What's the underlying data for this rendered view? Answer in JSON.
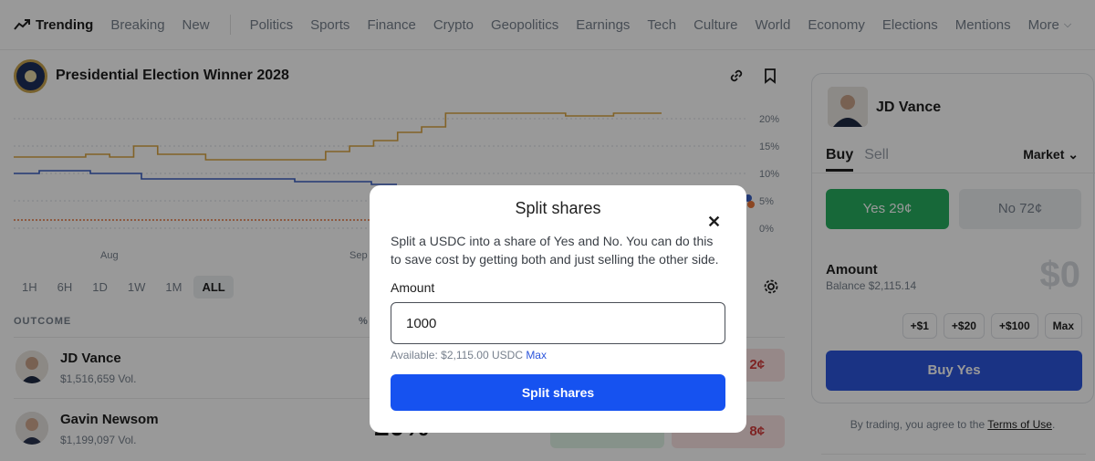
{
  "nav": {
    "trending": "Trending",
    "items": [
      "Breaking",
      "New"
    ],
    "categories": [
      "Politics",
      "Sports",
      "Finance",
      "Crypto",
      "Geopolitics",
      "Earnings",
      "Tech",
      "Culture",
      "World",
      "Economy",
      "Elections",
      "Mentions"
    ],
    "more": "More"
  },
  "market": {
    "title": "Presidential Election Winner 2028"
  },
  "chart_data": {
    "type": "line",
    "x_tick_labels": [
      "Aug",
      "Sep"
    ],
    "y_tick_labels": [
      "20%",
      "15%",
      "10%",
      "5%",
      "0%"
    ],
    "ylim": [
      0,
      21
    ],
    "grid": true,
    "series": [
      {
        "color": "#d9a441",
        "values": [
          13,
          13,
          13,
          13.5,
          13,
          15,
          13.5,
          13.5,
          12.5,
          12.5,
          12.5,
          12.5,
          12.5,
          14,
          15,
          16,
          17.5,
          18.5,
          21,
          21,
          21,
          21,
          21,
          20.5,
          20.5,
          21,
          21,
          21
        ]
      },
      {
        "color": "#3a5fc1",
        "values": [
          10,
          10.5,
          10.5,
          10,
          10,
          9,
          9,
          9,
          9,
          9,
          9,
          8.5,
          8.5,
          8.5,
          8,
          8
        ]
      },
      {
        "color": "#e8763a",
        "values": [
          1.5,
          1.5,
          1.5,
          1.5,
          1.5,
          1.5,
          1.5,
          1.5,
          1.5,
          1.5,
          1.5,
          1.5,
          1.5,
          1.5,
          1.5,
          1.5,
          3,
          4
        ]
      }
    ]
  },
  "ranges": [
    "1H",
    "6H",
    "1D",
    "1W",
    "1M",
    "ALL"
  ],
  "active_range": "ALL",
  "table": {
    "outcome_header": "OUTCOME",
    "pct_header": "%",
    "rows": [
      {
        "name": "JD Vance",
        "vol": "$1,516,659 Vol.",
        "pct": "",
        "no": "2¢"
      },
      {
        "name": "Gavin Newsom",
        "vol": "$1,199,097 Vol.",
        "pct": "20%",
        "no": "8¢"
      }
    ]
  },
  "panel": {
    "name": "JD Vance",
    "buy": "Buy",
    "sell": "Sell",
    "market": "Market",
    "yes": "Yes 29¢",
    "no": "No 72¢",
    "amount_label": "Amount",
    "balance": "Balance $2,115.14",
    "amount_value": "$0",
    "quick": [
      "+$1",
      "+$20",
      "+$100",
      "Max"
    ],
    "buy_button": "Buy Yes",
    "terms_prefix": "By trading, you agree to the ",
    "terms_link": "Terms of Use",
    "terms_suffix": "."
  },
  "modal": {
    "title": "Split shares",
    "close": "✕",
    "description": "Split a USDC into a share of Yes and No. You can do this to save cost by getting both and just selling the other side.",
    "amount_label": "Amount",
    "amount_value": "1000",
    "available": "Available: $2,115.00 USDC ",
    "max": "Max",
    "button": "Split shares"
  }
}
